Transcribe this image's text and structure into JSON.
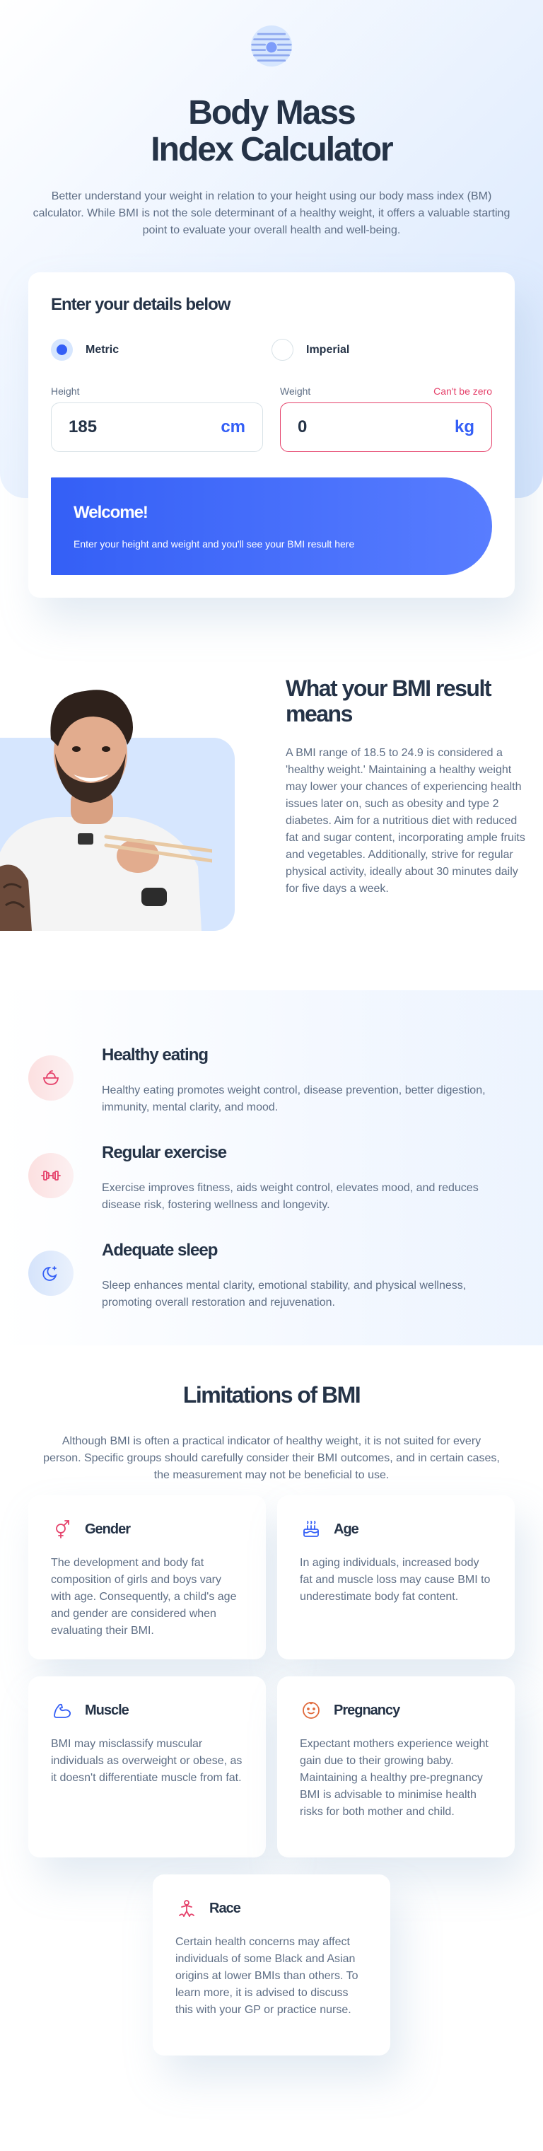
{
  "colors": {
    "accent": "#345FF6",
    "error": "#E5426B",
    "dark": "#253347",
    "muted": "#5E6E85",
    "light_blue": "#D6E6FE"
  },
  "hero": {
    "logo_icon": "bmi-logo-icon",
    "title_line1": "Body Mass",
    "title_line2": "Index Calculator",
    "intro": "Better understand your weight in relation to your height using our body mass index (BM) calculator. While BMI is not the sole determinant of a healthy weight, it offers a valuable starting point to evaluate your overall health and well-being."
  },
  "calculator": {
    "heading": "Enter your details below",
    "units": {
      "metric": "Metric",
      "imperial": "Imperial",
      "selected": "metric"
    },
    "height": {
      "label": "Height",
      "value": "185",
      "unit": "cm"
    },
    "weight": {
      "label": "Weight",
      "value": "0",
      "unit": "kg",
      "error": "Can't be zero"
    },
    "result": {
      "title": "Welcome!",
      "text": "Enter your height and weight and you'll see your BMI result here"
    }
  },
  "meaning": {
    "title": "What your BMI result means",
    "text": "A BMI range of 18.5 to 24.9 is considered a 'healthy weight.' Maintaining a healthy weight may lower your chances of experiencing health issues later on, such as obesity and type 2 diabetes. Aim for a nutritious diet with reduced fat and sugar content, incorporating ample fruits and vegetables. Additionally, strive for regular physical activity, ideally about 30 minutes daily for five days a week."
  },
  "tips": [
    {
      "icon": "bowl-icon",
      "title": "Healthy eating",
      "text": "Healthy eating promotes weight control, disease prevention, better digestion, immunity, mental clarity, and mood."
    },
    {
      "icon": "dumbbell-icon",
      "title": "Regular exercise",
      "text": "Exercise improves fitness, aids weight control, elevates mood, and reduces disease risk, fostering wellness and longevity."
    },
    {
      "icon": "moon-icon",
      "title": "Adequate sleep",
      "text": "Sleep enhances mental clarity, emotional stability, and physical wellness, promoting overall restoration and rejuvenation."
    }
  ],
  "limitations": {
    "title": "Limitations of BMI",
    "intro": "Although BMI is often a practical indicator of healthy weight, it is not suited for every person. Specific groups should carefully consider their BMI outcomes, and in certain cases, the measurement may not be beneficial to use.",
    "cards": [
      {
        "icon": "gender-icon",
        "title": "Gender",
        "text": "The development and body fat composition of girls and boys vary with age. Consequently, a child's age and gender are considered when evaluating their BMI."
      },
      {
        "icon": "cake-icon",
        "title": "Age",
        "text": "In aging individuals, increased body fat and muscle loss may cause BMI to underestimate body fat content."
      },
      {
        "icon": "muscle-icon",
        "title": "Muscle",
        "text": "BMI may misclassify muscular individuals as overweight or obese, as it doesn't differentiate muscle from fat."
      },
      {
        "icon": "pregnancy-icon",
        "title": "Pregnancy",
        "text": "Expectant mothers experience weight gain due to their growing baby. Maintaining a healthy pre-pregnancy BMI is advisable to minimise health risks for both mother and child."
      },
      {
        "icon": "race-icon",
        "title": "Race",
        "text": "Certain health concerns may affect individuals of some Black and Asian origins at lower BMIs than others. To learn more, it is advised to discuss this with your GP or practice nurse."
      }
    ]
  }
}
